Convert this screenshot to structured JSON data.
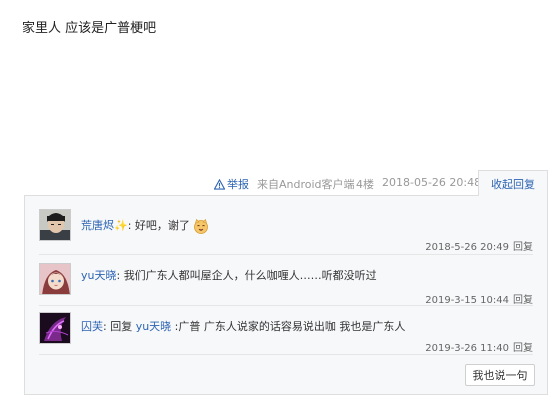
{
  "post": {
    "text": "家里人 应该是广普梗吧"
  },
  "meta": {
    "report_label": "举报",
    "client": "来自Android客户端",
    "floor": "4楼",
    "time": "2018-05-26 20:48",
    "collapse_label": "收起回复"
  },
  "replies": [
    {
      "user": "荒唐烬",
      "user_decoration": "✨",
      "sep": ": ",
      "text": "好吧，谢了",
      "emoji": "smiling-cat-emoji",
      "time": "2018-5-26 20:49",
      "reply_label": "回复"
    },
    {
      "user": "yu天晓",
      "sep": ": ",
      "text": "我们广东人都叫屋企人，什么咖喱人……听都没听过",
      "time": "2019-3-15 10:44",
      "reply_label": "回复"
    },
    {
      "user": "囚芙",
      "sep": ": ",
      "reply_word": "回复 ",
      "reply_target": "yu天晓",
      "text": " :广普 广东人说家的话容易说出咖 我也是广东人",
      "time": "2019-3-26 11:40",
      "reply_label": "回复"
    }
  ],
  "my_reply_button": "我也说一句",
  "colors": {
    "link": "#2d64b3",
    "reply_bg": "#f7f8fa",
    "border": "#dedede"
  }
}
